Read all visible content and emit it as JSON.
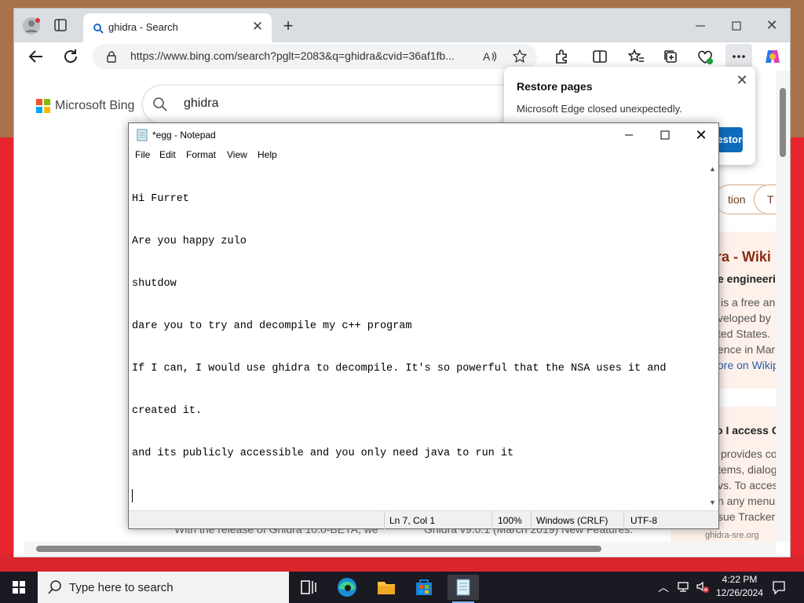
{
  "browser": {
    "tab_title": "ghidra - Search",
    "url": "https://www.bing.com/search?pglt=2083&q=ghidra&cvid=36af1fb...",
    "new_tab": "+",
    "close_tab": "✕",
    "close_window": "✕"
  },
  "bing": {
    "logo_text": "Microsoft Bing",
    "query": "ghidra",
    "pill_1": "tion",
    "pill_2": "T",
    "wiki_title": "ra - Wiki",
    "wiki_subtitle": "e engineeri",
    "wiki_lines": [
      "is a free an",
      "veloped by",
      "ted States.",
      "ence in Mar",
      "ore on Wikip"
    ],
    "card2_title": "o I access G",
    "card2_lines": [
      "provides co",
      "tems, dialog",
      "vs. To acces",
      "n any menu",
      "sue Tracker"
    ],
    "snippet_1": "With the release of Ghidra 10.0-BETA, we",
    "snippet_2": "Ghidra v9.0.1 (March 2019) New Features:",
    "snippet_3": "ghidra-sre.org"
  },
  "restore_popup": {
    "title": "Restore pages",
    "message": "Microsoft Edge closed unexpectedly.",
    "button": "Restore",
    "close": "✕"
  },
  "notepad": {
    "title": "*egg - Notepad",
    "close": "✕",
    "menu": [
      "File",
      "Edit",
      "Format",
      "View",
      "Help"
    ],
    "lines": [
      "Hi Furret",
      "Are you happy zulo",
      "shutdow",
      "dare you to try and decompile my c++ program",
      "If I can, I would use ghidra to decompile. It's so powerful that the NSA uses it and",
      "created it.",
      "and its publicly accessible and you only need java to run it"
    ],
    "status": {
      "position": "Ln 7, Col 1",
      "zoom": "100%",
      "line_ending": "Windows (CRLF)",
      "encoding": "UTF-8"
    }
  },
  "taskbar": {
    "search_placeholder": "Type here to search",
    "time": "4:22 PM",
    "date": "12/26/2024",
    "tray_arrow": "︿"
  },
  "colors": {
    "desktop_red": "#e8242c",
    "edge_accent": "#0f6cbd",
    "taskbar": "#1a1a22"
  }
}
